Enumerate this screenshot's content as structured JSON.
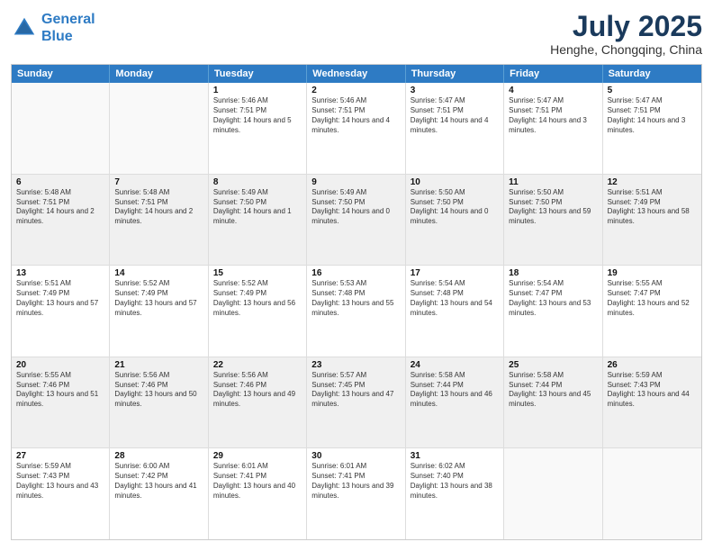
{
  "logo": {
    "line1": "General",
    "line2": "Blue"
  },
  "title": "July 2025",
  "location": "Henghe, Chongqing, China",
  "weekdays": [
    "Sunday",
    "Monday",
    "Tuesday",
    "Wednesday",
    "Thursday",
    "Friday",
    "Saturday"
  ],
  "rows": [
    [
      {
        "day": "",
        "text": "",
        "empty": true
      },
      {
        "day": "",
        "text": "",
        "empty": true
      },
      {
        "day": "1",
        "text": "Sunrise: 5:46 AM\nSunset: 7:51 PM\nDaylight: 14 hours and 5 minutes."
      },
      {
        "day": "2",
        "text": "Sunrise: 5:46 AM\nSunset: 7:51 PM\nDaylight: 14 hours and 4 minutes."
      },
      {
        "day": "3",
        "text": "Sunrise: 5:47 AM\nSunset: 7:51 PM\nDaylight: 14 hours and 4 minutes."
      },
      {
        "day": "4",
        "text": "Sunrise: 5:47 AM\nSunset: 7:51 PM\nDaylight: 14 hours and 3 minutes."
      },
      {
        "day": "5",
        "text": "Sunrise: 5:47 AM\nSunset: 7:51 PM\nDaylight: 14 hours and 3 minutes."
      }
    ],
    [
      {
        "day": "6",
        "text": "Sunrise: 5:48 AM\nSunset: 7:51 PM\nDaylight: 14 hours and 2 minutes.",
        "shaded": true
      },
      {
        "day": "7",
        "text": "Sunrise: 5:48 AM\nSunset: 7:51 PM\nDaylight: 14 hours and 2 minutes.",
        "shaded": true
      },
      {
        "day": "8",
        "text": "Sunrise: 5:49 AM\nSunset: 7:50 PM\nDaylight: 14 hours and 1 minute.",
        "shaded": true
      },
      {
        "day": "9",
        "text": "Sunrise: 5:49 AM\nSunset: 7:50 PM\nDaylight: 14 hours and 0 minutes.",
        "shaded": true
      },
      {
        "day": "10",
        "text": "Sunrise: 5:50 AM\nSunset: 7:50 PM\nDaylight: 14 hours and 0 minutes.",
        "shaded": true
      },
      {
        "day": "11",
        "text": "Sunrise: 5:50 AM\nSunset: 7:50 PM\nDaylight: 13 hours and 59 minutes.",
        "shaded": true
      },
      {
        "day": "12",
        "text": "Sunrise: 5:51 AM\nSunset: 7:49 PM\nDaylight: 13 hours and 58 minutes.",
        "shaded": true
      }
    ],
    [
      {
        "day": "13",
        "text": "Sunrise: 5:51 AM\nSunset: 7:49 PM\nDaylight: 13 hours and 57 minutes."
      },
      {
        "day": "14",
        "text": "Sunrise: 5:52 AM\nSunset: 7:49 PM\nDaylight: 13 hours and 57 minutes."
      },
      {
        "day": "15",
        "text": "Sunrise: 5:52 AM\nSunset: 7:49 PM\nDaylight: 13 hours and 56 minutes."
      },
      {
        "day": "16",
        "text": "Sunrise: 5:53 AM\nSunset: 7:48 PM\nDaylight: 13 hours and 55 minutes."
      },
      {
        "day": "17",
        "text": "Sunrise: 5:54 AM\nSunset: 7:48 PM\nDaylight: 13 hours and 54 minutes."
      },
      {
        "day": "18",
        "text": "Sunrise: 5:54 AM\nSunset: 7:47 PM\nDaylight: 13 hours and 53 minutes."
      },
      {
        "day": "19",
        "text": "Sunrise: 5:55 AM\nSunset: 7:47 PM\nDaylight: 13 hours and 52 minutes."
      }
    ],
    [
      {
        "day": "20",
        "text": "Sunrise: 5:55 AM\nSunset: 7:46 PM\nDaylight: 13 hours and 51 minutes.",
        "shaded": true
      },
      {
        "day": "21",
        "text": "Sunrise: 5:56 AM\nSunset: 7:46 PM\nDaylight: 13 hours and 50 minutes.",
        "shaded": true
      },
      {
        "day": "22",
        "text": "Sunrise: 5:56 AM\nSunset: 7:46 PM\nDaylight: 13 hours and 49 minutes.",
        "shaded": true
      },
      {
        "day": "23",
        "text": "Sunrise: 5:57 AM\nSunset: 7:45 PM\nDaylight: 13 hours and 47 minutes.",
        "shaded": true
      },
      {
        "day": "24",
        "text": "Sunrise: 5:58 AM\nSunset: 7:44 PM\nDaylight: 13 hours and 46 minutes.",
        "shaded": true
      },
      {
        "day": "25",
        "text": "Sunrise: 5:58 AM\nSunset: 7:44 PM\nDaylight: 13 hours and 45 minutes.",
        "shaded": true
      },
      {
        "day": "26",
        "text": "Sunrise: 5:59 AM\nSunset: 7:43 PM\nDaylight: 13 hours and 44 minutes.",
        "shaded": true
      }
    ],
    [
      {
        "day": "27",
        "text": "Sunrise: 5:59 AM\nSunset: 7:43 PM\nDaylight: 13 hours and 43 minutes."
      },
      {
        "day": "28",
        "text": "Sunrise: 6:00 AM\nSunset: 7:42 PM\nDaylight: 13 hours and 41 minutes."
      },
      {
        "day": "29",
        "text": "Sunrise: 6:01 AM\nSunset: 7:41 PM\nDaylight: 13 hours and 40 minutes."
      },
      {
        "day": "30",
        "text": "Sunrise: 6:01 AM\nSunset: 7:41 PM\nDaylight: 13 hours and 39 minutes."
      },
      {
        "day": "31",
        "text": "Sunrise: 6:02 AM\nSunset: 7:40 PM\nDaylight: 13 hours and 38 minutes."
      },
      {
        "day": "",
        "text": "",
        "empty": true
      },
      {
        "day": "",
        "text": "",
        "empty": true
      }
    ]
  ]
}
